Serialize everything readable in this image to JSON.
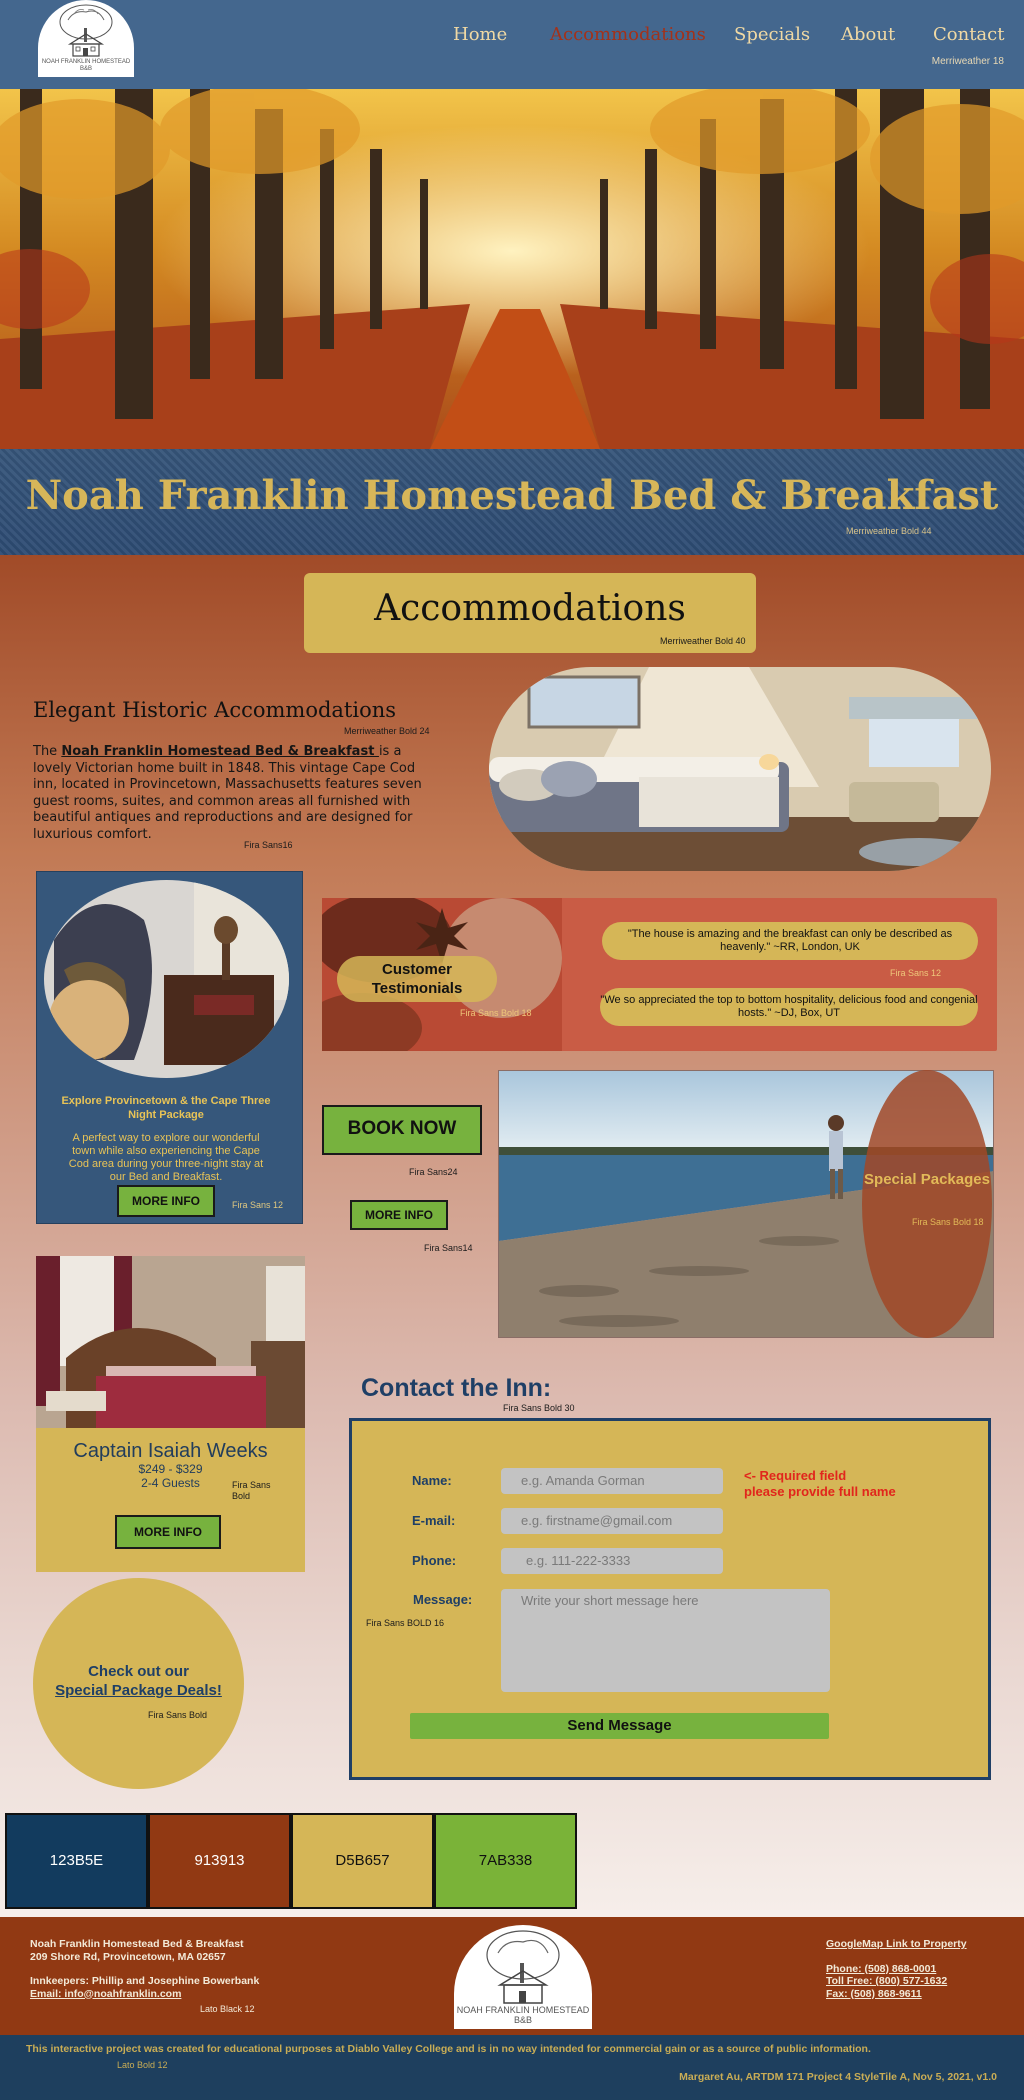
{
  "logo": {
    "line1": "NOAH FRANKLIN HOMESTEAD",
    "line2": "B&B"
  },
  "nav": {
    "items": [
      "Home",
      "Accommodations",
      "Specials",
      "About",
      "Contact"
    ],
    "active": "Accommodations",
    "note": "Merriweather 18"
  },
  "hero": {
    "title": "Noah Franklin Homestead Bed & Breakfast",
    "title_note": "Merriweather Bold 44"
  },
  "accommodations": {
    "heading": "Accommodations",
    "heading_note": "Merriweather Bold 40",
    "subheading": "Elegant Historic Accommodations",
    "subheading_note": "Merriweather Bold 24",
    "intro_prefix": "The ",
    "intro_link": "Noah Franklin Homestead Bed & Breakfast ",
    "intro_rest": "is a lovely Victorian home built in 1848. This vintage Cape Cod inn, located in Provincetown, Massachusetts features seven guest rooms, suites, and common areas all furnished with beautiful antiques and reproductions and are designed for luxurious comfort.",
    "intro_note": "Fira Sans16"
  },
  "provincetown": {
    "title": "Explore Provincetown & the Cape Three Night Package",
    "body": "A perfect way to explore our wonderful town while also experiencing the Cape Cod area during your three-night stay at our Bed and Breakfast.",
    "button": "MORE INFO",
    "note": "Fira Sans 12"
  },
  "testimonials": {
    "label": "Customer Testimonials",
    "label_note": "Fira Sans  Bold 18",
    "quote1": "\"The house is amazing and the breakfast can only be described as heavenly.\" ~RR, London, UK",
    "quote2": "\"We so appreciated the top to bottom hospitality, delicious food and congenial hosts.\" ~DJ, Box, UT",
    "quote_note": "Fira Sans  12"
  },
  "booking": {
    "book_now": "BOOK NOW",
    "book_note": "Fira Sans24",
    "more_info": "MORE INFO",
    "more_note": "Fira Sans14"
  },
  "special": {
    "label": "Special Packages",
    "note": "Fira Sans  Bold 18"
  },
  "captain": {
    "name": "Captain Isaiah Weeks",
    "price": "$249 - $329",
    "guests": "2-4 Guests",
    "note": "Fira Sans Bold",
    "button": "MORE INFO"
  },
  "deals": {
    "line1": "Check out our",
    "line2": "Special Package Deals!",
    "note": "Fira Sans Bold"
  },
  "contact": {
    "heading": "Contact the Inn:",
    "heading_note": "Fira Sans Bold 30",
    "name_label": "Name:",
    "name_placeholder": "e.g. Amanda Gorman",
    "email_label": "E-mail:",
    "email_placeholder": "e.g. firstname@gmail.com",
    "phone_label": "Phone:",
    "phone_placeholder": "e.g. 111-222-3333",
    "message_label": "Message:",
    "message_placeholder": "Write your short message here",
    "label_note": "Fira Sans BOLD 16",
    "required_line1": "<- Required field",
    "required_line2": "please provide full name",
    "send": "Send Message"
  },
  "swatches": [
    {
      "hex": "123B5E",
      "color": "#123B5E",
      "text_color": "#ffffff"
    },
    {
      "hex": "913913",
      "color": "#913913",
      "text_color": "#ffffff"
    },
    {
      "hex": "D5B657",
      "color": "#D5B657",
      "text_color": "#111111"
    },
    {
      "hex": "7AB338",
      "color": "#7AB338",
      "text_color": "#111111"
    }
  ],
  "footer": {
    "name": "Noah Franklin Homestead Bed & Breakfast",
    "address": "209 Shore Rd, Provincetown, MA 02657",
    "innkeepers": "Innkeepers: Phillip and Josephine Bowerbank",
    "email": "Email: info@noahfranklin.com",
    "note": "Lato Black 12",
    "map_link": "GoogleMap Link to Property",
    "phone": "Phone: (508) 868-0001",
    "toll_free": "Toll Free: (800) 577-1632",
    "fax": "Fax: (508) 868-9611",
    "disclaimer": "This interactive project was created for educational purposes at Diablo Valley College and is in no way intended for commercial gain or as a source of public information.",
    "disclaimer_note": "Lato Bold 12",
    "credit": "Margaret Au, ARTDM 171 Project 4 StyleTile A, Nov 5, 2021, v1.0"
  }
}
